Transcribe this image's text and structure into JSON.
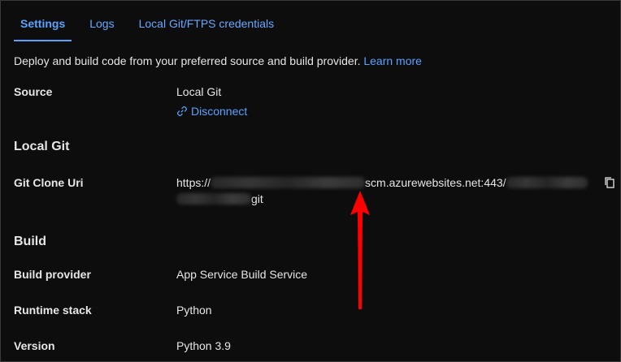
{
  "tabs": [
    {
      "label": "Settings",
      "active": true
    },
    {
      "label": "Logs",
      "active": false
    },
    {
      "label": "Local Git/FTPS credentials",
      "active": false
    }
  ],
  "intro": {
    "text": "Deploy and build code from your preferred source and build provider. ",
    "link": "Learn more"
  },
  "source": {
    "label": "Source",
    "value": "Local Git",
    "disconnect_label": "Disconnect",
    "disconnect_icon": "unlink-icon"
  },
  "local_git": {
    "title": "Local Git",
    "clone_uri_label": "Git Clone Uri",
    "uri_prefix": "https://",
    "uri_host_suffix": "scm.azurewebsites.net:443/",
    "uri_suffix": "git",
    "copy_icon": "copy-icon"
  },
  "build": {
    "title": "Build",
    "provider_label": "Build provider",
    "provider_value": "App Service Build Service",
    "runtime_label": "Runtime stack",
    "runtime_value": "Python",
    "version_label": "Version",
    "version_value": "Python 3.9"
  },
  "colors": {
    "background": "#0d0d0d",
    "link": "#5aa2ff",
    "text": "#e6e6e6",
    "arrow": "#ff0000"
  }
}
